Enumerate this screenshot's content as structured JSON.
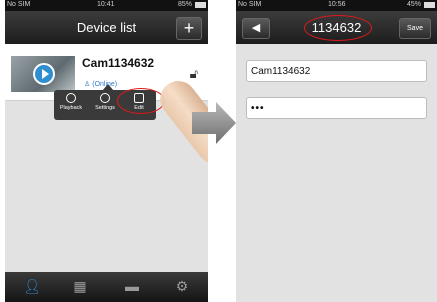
{
  "left_screen": {
    "status": {
      "carrier": "No SIM",
      "time": "10:41",
      "battery": "85%"
    },
    "nav": {
      "title": "Device list",
      "add_label": "+"
    },
    "device": {
      "name": "Cam1134632",
      "status": "(Online)"
    },
    "popup": {
      "playback": "Playback",
      "settings": "Settings",
      "edit": "Edit"
    },
    "tabs": [
      {
        "icon": "person-icon"
      },
      {
        "icon": "grid-icon"
      },
      {
        "icon": "toolbox-icon"
      },
      {
        "icon": "gear-icon"
      }
    ]
  },
  "right_screen": {
    "status": {
      "carrier": "No SIM",
      "time": "10:56",
      "battery": "45%"
    },
    "nav": {
      "title": "1134632",
      "save_label": "Save",
      "back_icon": "back-arrow-icon"
    },
    "fields": {
      "name_value": "Cam1134632",
      "password_value": "•••"
    }
  },
  "colors": {
    "accent": "#2f8fd0",
    "highlight": "#e01818"
  }
}
